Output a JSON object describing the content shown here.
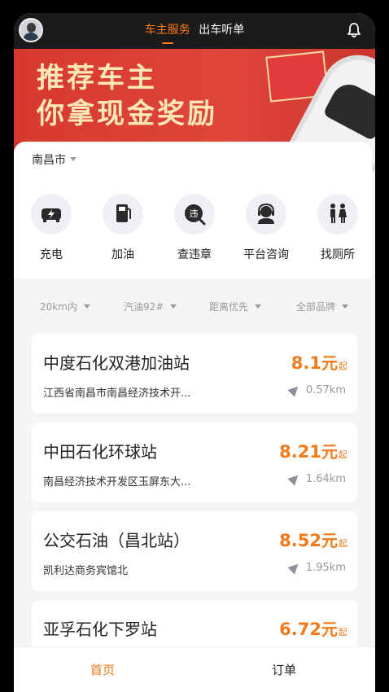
{
  "header": {
    "tabs": [
      {
        "label": "车主服务",
        "active": true
      },
      {
        "label": "出车听单",
        "active": false
      }
    ]
  },
  "banner": {
    "line1": "推荐车主",
    "line2": "你拿现金奖励"
  },
  "location": {
    "city": "南昌市"
  },
  "services": [
    {
      "label": "充电",
      "icon": "charging-car-icon"
    },
    {
      "label": "加油",
      "icon": "fuel-pump-icon"
    },
    {
      "label": "查违章",
      "icon": "violation-check-icon"
    },
    {
      "label": "平台咨询",
      "icon": "customer-service-icon"
    },
    {
      "label": "找厕所",
      "icon": "restroom-icon"
    }
  ],
  "filters": [
    {
      "label": "20km内"
    },
    {
      "label": "汽油92#"
    },
    {
      "label": "距离优先"
    },
    {
      "label": "全部品牌"
    }
  ],
  "stations": [
    {
      "name": "中度石化双港加油站",
      "address": "江西省南昌市南昌经济技术开...",
      "price": "8.1",
      "unit": "元",
      "suffix": "起",
      "distance": "0.57km"
    },
    {
      "name": "中田石化环球站",
      "address": "南昌经济技术开发区玉屏东大...",
      "price": "8.21",
      "unit": "元",
      "suffix": "起",
      "distance": "1.64km"
    },
    {
      "name": "公交石油（昌北站）",
      "address": "凯利达商务宾馆北",
      "price": "8.52",
      "unit": "元",
      "suffix": "起",
      "distance": "1.95km"
    },
    {
      "name": "亚孚石化下罗站",
      "address": "",
      "price": "6.72",
      "unit": "元",
      "suffix": "起",
      "distance": ""
    }
  ],
  "bottom_nav": [
    {
      "label": "首页",
      "active": true
    },
    {
      "label": "订单",
      "active": false
    }
  ],
  "colors": {
    "accent": "#f27a1a",
    "header_bg": "#1b1b1b",
    "banner_red": "#e0453a",
    "banner_text": "#ffe7b8"
  }
}
